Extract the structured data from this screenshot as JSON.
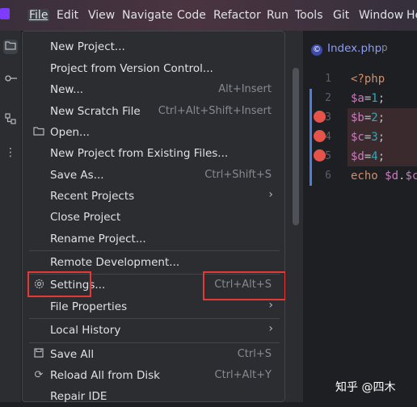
{
  "menubar": {
    "items": [
      "File",
      "Edit",
      "View",
      "Navigate",
      "Code",
      "Refactor",
      "Run",
      "Tools",
      "Git",
      "Window",
      "He"
    ]
  },
  "file_menu": {
    "items": [
      {
        "label": "New Project...",
        "shortcut": ""
      },
      {
        "label": "Project from Version Control...",
        "shortcut": ""
      },
      {
        "label": "New...",
        "shortcut": "Alt+Insert"
      },
      {
        "label": "New Scratch File",
        "shortcut": "Ctrl+Alt+Shift+Insert"
      },
      {
        "label": "Open...",
        "shortcut": ""
      },
      {
        "label": "New Project from Existing Files...",
        "shortcut": ""
      },
      {
        "label": "Save As...",
        "shortcut": "Ctrl+Shift+S"
      },
      {
        "label": "Recent Projects",
        "shortcut": ""
      },
      {
        "label": "Close Project",
        "shortcut": ""
      },
      {
        "label": "Rename Project...",
        "shortcut": ""
      },
      {
        "label": "Remote Development...",
        "shortcut": ""
      },
      {
        "label": "Settings...",
        "shortcut": "Ctrl+Alt+S"
      },
      {
        "label": "File Properties",
        "shortcut": ""
      },
      {
        "label": "Local History",
        "shortcut": ""
      },
      {
        "label": "Save All",
        "shortcut": "Ctrl+S"
      },
      {
        "label": "Reload All from Disk",
        "shortcut": "Ctrl+Alt+Y"
      },
      {
        "label": "Repair IDE",
        "shortcut": ""
      }
    ]
  },
  "editor": {
    "tab_label": "Index.php",
    "tab_extra": "p",
    "line_numbers": [
      "1",
      "2",
      "3",
      "4",
      "5",
      "6"
    ],
    "lines": {
      "l1": "<?php",
      "l2_var": "$a",
      "l2_rest": "=",
      "l2_num": "1",
      "l2_end": ";",
      "l3_var": "$b",
      "l3_rest": "=",
      "l3_num": "2",
      "l3_end": ";",
      "l4_var": "$c",
      "l4_rest": "=",
      "l4_num": "3",
      "l4_end": ";",
      "l5_var": "$d",
      "l5_rest": "=",
      "l5_num": "4",
      "l5_end": ";",
      "l6_kw": "echo ",
      "l6_a": "$d",
      "l6_b": ".",
      "l6_c": "$c"
    }
  },
  "watermark": "知乎 @四木",
  "colors": {
    "highlight_box": "#e53935",
    "breakpoint": "#e5534b",
    "accent": "#4f7ddb"
  },
  "icons": [
    "app-logo-icon",
    "folder-icon",
    "commit-icon",
    "structure-icon",
    "more-icon",
    "gear-icon",
    "save-icon",
    "reload-icon",
    "chevron-right-icon",
    "php-file-icon"
  ]
}
